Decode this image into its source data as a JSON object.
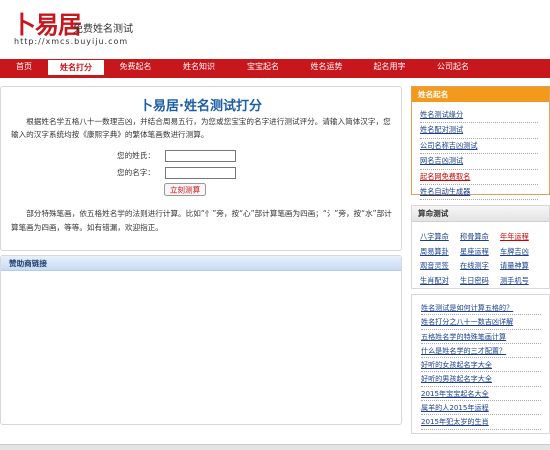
{
  "header": {
    "logo": "卜易居",
    "subtitle": "免费姓名测试",
    "url": "http://xmcs.buyiju.com"
  },
  "nav": [
    "首页",
    "姓名打分",
    "免费起名",
    "姓名知识",
    "宝宝起名",
    "姓名运势",
    "起名用字",
    "公司起名"
  ],
  "main": {
    "title": "卜易居·姓名测试打分",
    "intro": "根据姓名学五格八十一数理吉凶，并结合周易五行，为您或您宝宝的名字进行测试评分。请输入简体汉字，您输入的汉字系统均按《康熙字典》的繁体笔画数进行测算。",
    "surname_label": "您的姓氏：",
    "name_label": "您的名字：",
    "surname_value": "",
    "name_value": "",
    "submit": "立刻测算",
    "note": "部分特殊笔画，依五格姓名学的法则进行计算。比如“忄”旁，按“心”部计算笔画为四画；“氵”旁，按“水”部计算笔画为四画，等等。如有错漏，欢迎指正。"
  },
  "sponsor": {
    "heading": "赞助商链接"
  },
  "naming": {
    "heading": "姓名起名",
    "items": [
      "姓名测试缘分",
      "姓名配对测试",
      "公司名称吉凶测试",
      "网名吉凶测试",
      "起名网免费取名",
      "姓名自动生成器"
    ]
  },
  "suanming": {
    "heading": "算命测试",
    "items": [
      "八字算命",
      "称骨算命",
      "年年运程",
      "周易算卦",
      "星座运程",
      "车牌吉凶",
      "观音灵签",
      "在线测字",
      "请量神算",
      "生肖配对",
      "生日密码",
      "测手机号"
    ]
  },
  "articles": {
    "items": [
      "姓名测试是如何计算五格的？",
      "姓名打分之八十一数吉凶详解",
      "五格姓名学的特殊笔画计算",
      "什么是姓名学的三才配置？",
      "好听的女孩起名字大全",
      "好听的男孩起名字大全",
      "2015年宝宝起名大全",
      "属羊的人2015年运程",
      "2015年犯太岁的生肖"
    ]
  },
  "colors": {
    "brand_red": "#c8161d",
    "title_blue": "#1b5ea3",
    "link_blue": "#1a3f8f",
    "naming_orange": "#f39a1d",
    "highlight_red": "#cc0000"
  }
}
